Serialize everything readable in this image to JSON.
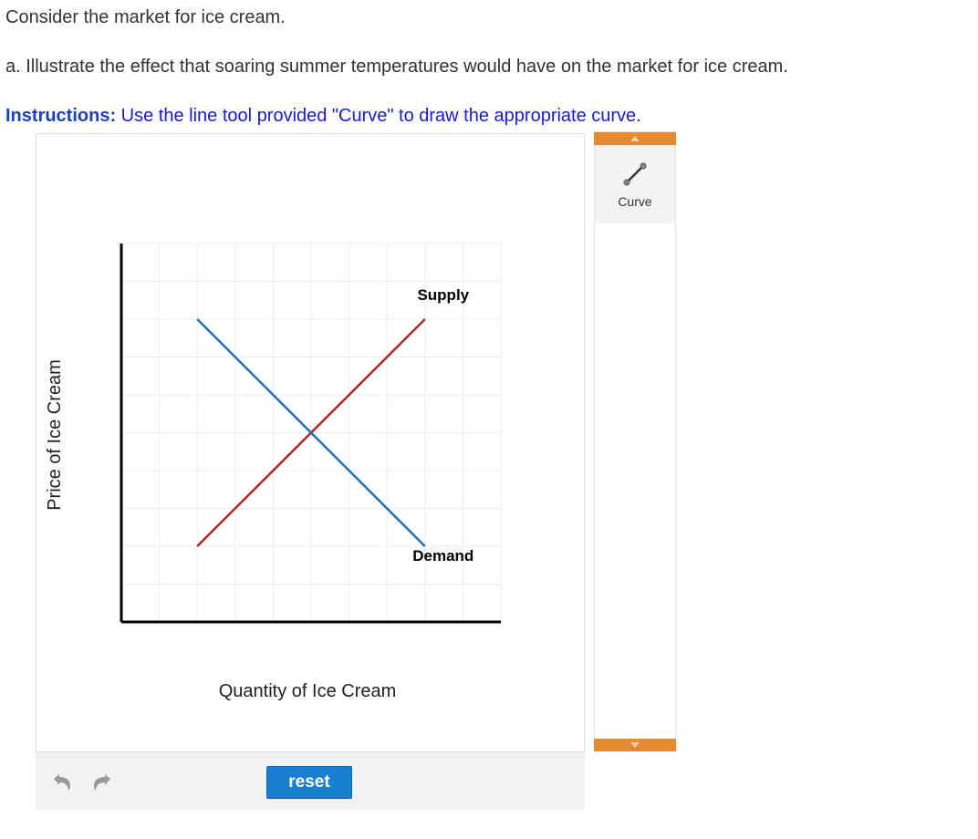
{
  "question": {
    "line1": "Consider the market for ice cream.",
    "line2": "a. Illustrate the effect that soaring summer temperatures would have on the market for ice cream.",
    "instructions_label": "Instructions:",
    "instructions_text": " Use the line tool provided \"Curve\" to draw the appropriate curve."
  },
  "toolbox": {
    "tools": [
      {
        "label": "Curve",
        "icon": "line-segment-icon"
      }
    ],
    "accent_color": "#e58a2e"
  },
  "controls": {
    "reset_label": "reset",
    "undo_icon": "undo-icon",
    "redo_icon": "redo-icon",
    "reset_color": "#1a7fd1"
  },
  "chart_data": {
    "type": "line",
    "xlabel": "Quantity of Ice Cream",
    "ylabel": "Price of Ice Cream",
    "xlim": [
      0,
      10
    ],
    "ylim": [
      0,
      10
    ],
    "grid": true,
    "series": [
      {
        "name": "Supply",
        "color": "#b52222",
        "x": [
          2,
          8
        ],
        "y": [
          2,
          8
        ]
      },
      {
        "name": "Demand",
        "color": "#1f6fbf",
        "x": [
          2,
          8
        ],
        "y": [
          8,
          2
        ]
      }
    ]
  }
}
